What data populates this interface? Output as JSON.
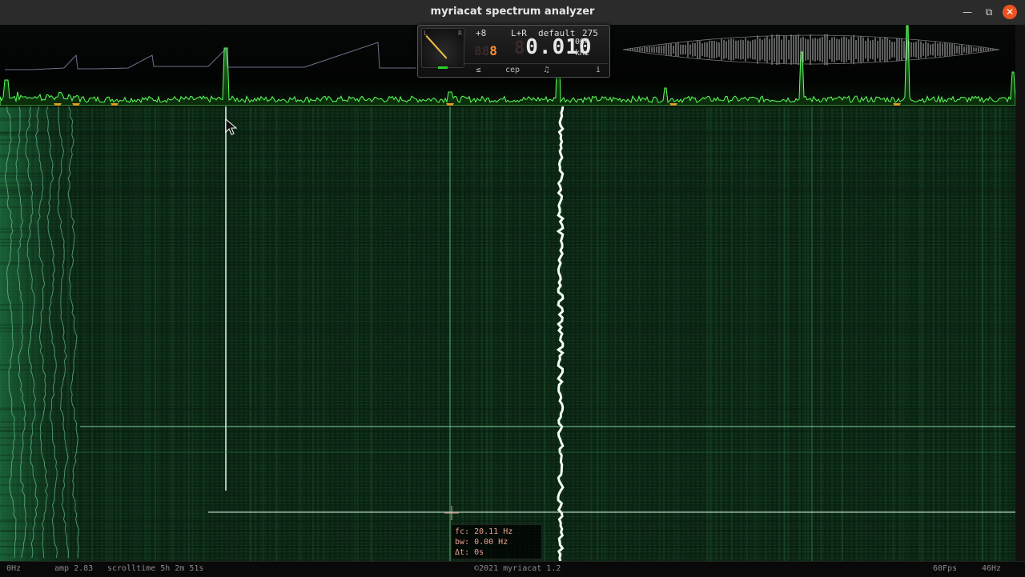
{
  "window": {
    "title": "myriacat spectrum analyzer",
    "controls": {
      "minimize": "minimize-icon",
      "maximize": "maximize-icon",
      "close": "close-icon"
    }
  },
  "widget": {
    "meter_labels": {
      "left": "L",
      "right": "R"
    },
    "gain": "+8",
    "octave_ghost": "88",
    "octave": "8",
    "channel": "L+R",
    "preset": "default",
    "preset_number": "275",
    "freq_ghost": "8",
    "freq_main": "0.010",
    "freq_sub": "004",
    "unit": "kHz",
    "tabs": [
      {
        "label": "≤",
        "name": "tab-filter"
      },
      {
        "label": "cep",
        "name": "tab-cep"
      },
      {
        "label": "♫",
        "name": "tab-notes"
      },
      {
        "label": "i",
        "name": "tab-info"
      }
    ]
  },
  "watermark": "myriacat",
  "readout": {
    "fc": "fc: 20.11 Hz",
    "bw": "bw: 0.00 Hz",
    "dt": "Δt: 0s"
  },
  "statusbar": {
    "min_freq": "0Hz",
    "amp": "amp 2.83",
    "scrolltime": "scrolltime 5h 2m 51s",
    "copyright": "©2021 myriacat 1.2",
    "fps": "60Fps",
    "max_freq": "46Hz"
  },
  "colors": {
    "spectrogram_bg": "#0d2a16",
    "trace": "#39e639",
    "marker": "#e0a020",
    "accent": "#e95420"
  },
  "markers_count": 8
}
